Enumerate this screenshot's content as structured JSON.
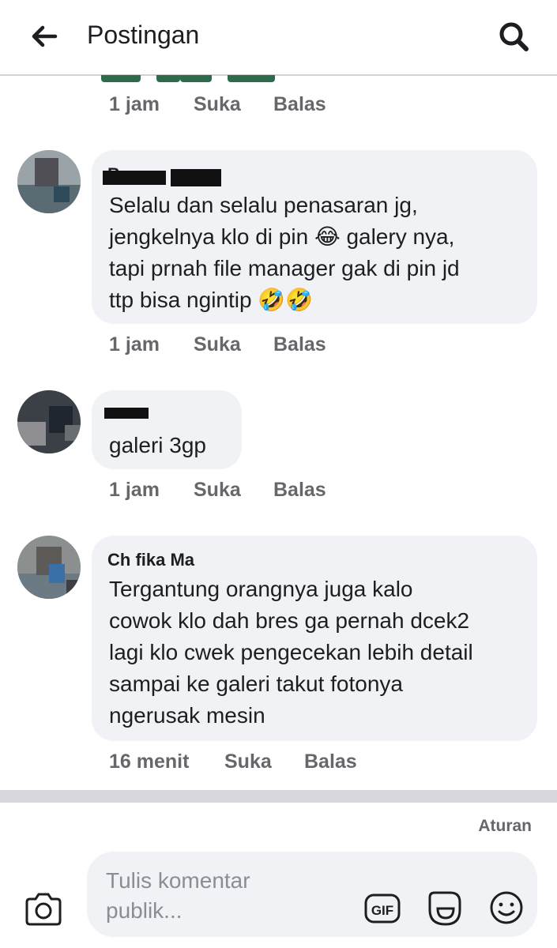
{
  "header": {
    "title": "Postingan"
  },
  "comments": [
    {
      "meta": {
        "time": "1 jam",
        "like": "Suka",
        "reply": "Balas"
      }
    },
    {
      "author": "Bo",
      "text": "Selalu dan selalu penasaran jg,\njengkelnya klo di pin 😂 galery nya,\ntapi prnah file manager gak di pin jd\nttp bisa ngintip 🤣🤣",
      "meta": {
        "time": "1 jam",
        "like": "Suka",
        "reply": "Balas"
      }
    },
    {
      "author": "",
      "text": "galeri 3gp",
      "meta": {
        "time": "1 jam",
        "like": "Suka",
        "reply": "Balas"
      }
    },
    {
      "author": "Ch fika Ma",
      "text": "Tergantung orangnya juga kalo\ncowok klo dah bres ga pernah dcek2\nlagi klo cwek pengecekan lebih detail\nsampai ke galeri takut fotonya\nngerusak mesin",
      "meta": {
        "time": "16 menit",
        "like": "Suka",
        "reply": "Balas"
      }
    }
  ],
  "footer": {
    "rules_label": "Aturan",
    "input_placeholder": "Tulis komentar publik..."
  },
  "icons": {
    "back": "arrow-left-icon",
    "search": "search-icon",
    "camera": "camera-icon",
    "gif": "gif-icon",
    "sticker": "sticker-icon",
    "emoji": "smiley-icon"
  },
  "colors": {
    "bubble": "#f0f2f5",
    "meta": "#65676b",
    "text": "#1c1e21",
    "divider": "#d6d8db"
  }
}
